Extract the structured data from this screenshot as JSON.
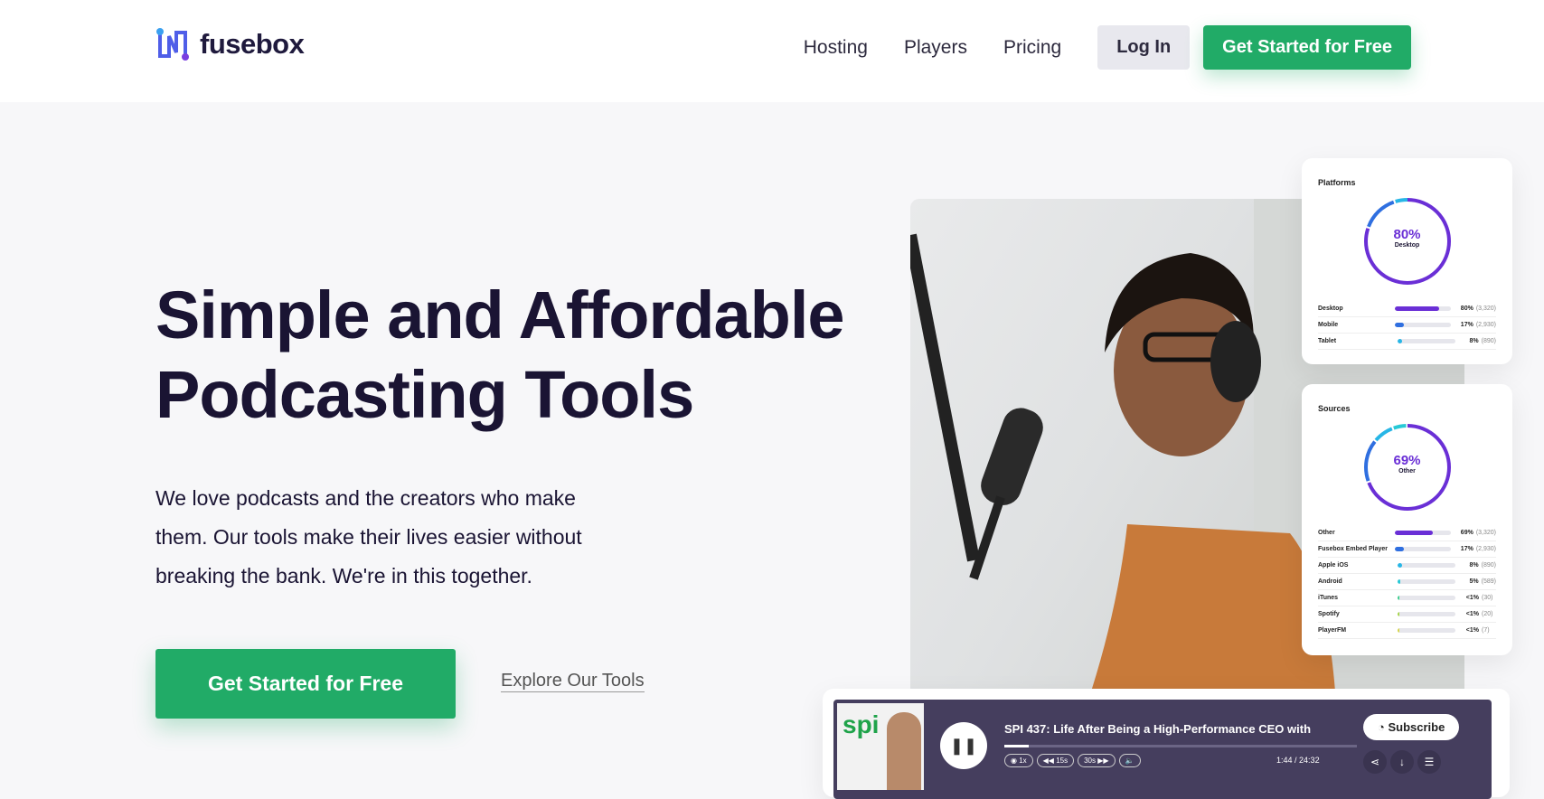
{
  "brand": {
    "name": "fusebox",
    "accent": "#21ab67",
    "purple": "#6a2fd6"
  },
  "nav": {
    "items": [
      "Hosting",
      "Players",
      "Pricing"
    ],
    "login": "Log In",
    "cta": "Get Started for Free"
  },
  "hero": {
    "title_line1": "Simple and Affordable",
    "title_line2": "Podcasting Tools",
    "lead": "We love podcasts and the creators who make them. Our tools make their lives easier without breaking the bank. We're in this together.",
    "cta": "Get Started for Free",
    "explore": "Explore Our Tools"
  },
  "platforms": {
    "title": "Platforms",
    "center_value": "80%",
    "center_label": "Desktop",
    "rows": [
      {
        "label": "Desktop",
        "pct": "80%",
        "count": "(3,320)",
        "value": 80,
        "color": "#6a2fd6"
      },
      {
        "label": "Mobile",
        "pct": "17%",
        "count": "(2,930)",
        "value": 17,
        "color": "#2f6fe0"
      },
      {
        "label": "Tablet",
        "pct": "8%",
        "count": "(890)",
        "value": 8,
        "color": "#27b6e6"
      }
    ]
  },
  "sources": {
    "title": "Sources",
    "center_value": "69%",
    "center_label": "Other",
    "rows": [
      {
        "label": "Other",
        "pct": "69%",
        "count": "(3,320)",
        "value": 69,
        "color": "#6a2fd6"
      },
      {
        "label": "Fusebox Embed Player",
        "pct": "17%",
        "count": "(2,930)",
        "value": 17,
        "color": "#2f6fe0"
      },
      {
        "label": "Apple iOS",
        "pct": "8%",
        "count": "(890)",
        "value": 8,
        "color": "#27b6e6"
      },
      {
        "label": "Android",
        "pct": "5%",
        "count": "(589)",
        "value": 5,
        "color": "#27c9d6"
      },
      {
        "label": "iTunes",
        "pct": "<1%",
        "count": "(30)",
        "value": 1,
        "color": "#3ccf8e"
      },
      {
        "label": "Spotify",
        "pct": "<1%",
        "count": "(20)",
        "value": 1,
        "color": "#a6d64a"
      },
      {
        "label": "PlayerFM",
        "pct": "<1%",
        "count": "(7)",
        "value": 1,
        "color": "#d6d64a"
      }
    ]
  },
  "player": {
    "art_text": "spi",
    "title": "SPI 437: Life After Being a High-Performance CEO with",
    "speed": "1x",
    "back": "15s",
    "fwd": "30s",
    "current": "1:44",
    "duration": "24:32",
    "progress": 0.07,
    "subscribe": "Subscribe"
  }
}
